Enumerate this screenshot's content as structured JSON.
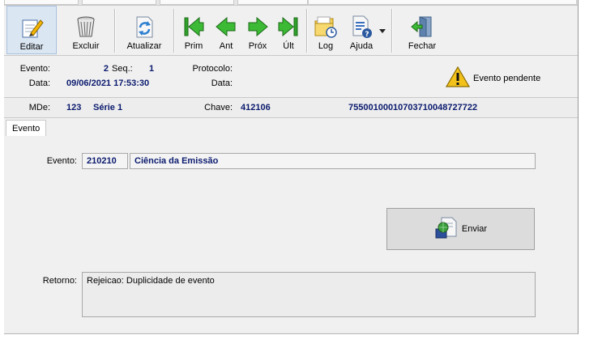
{
  "toolbar": {
    "editar": "Editar",
    "excluir": "Excluir",
    "atualizar": "Atualizar",
    "prim": "Prim",
    "ant": "Ant",
    "prox": "Próx",
    "ult": "Últ",
    "log": "Log",
    "ajuda": "Ajuda",
    "fechar": "Fechar"
  },
  "info": {
    "evento_label": "Evento:",
    "evento_value": "2",
    "seq_label": "Seq.:",
    "seq_value": "1",
    "protocolo_label": "Protocolo:",
    "protocolo_value": "",
    "data_label": "Data:",
    "data_value": "09/06/2021 17:53:30",
    "data2_label": "Data:",
    "data2_value": "",
    "status": "Evento pendente"
  },
  "mde": {
    "mde_label": "MDe:",
    "mde_number": "123",
    "serie": "Série 1",
    "chave_label": "Chave:",
    "chave_prefix": "412106",
    "chave_rest": "75500100010703710048727722"
  },
  "tabs": [
    "Evento"
  ],
  "form": {
    "evento_label": "Evento:",
    "evento_code": "210210",
    "evento_desc": "Ciência da Emissão",
    "enviar": "Enviar",
    "retorno_label": "Retorno:",
    "retorno_value": "Rejeicao: Duplicidade de evento"
  },
  "icons": {
    "editar": "pencil-notepad-icon",
    "excluir": "trash-bin-icon",
    "atualizar": "refresh-document-icon",
    "prim": "first-record-icon",
    "ant": "previous-record-icon",
    "prox": "next-record-icon",
    "ult": "last-record-icon",
    "log": "folder-clock-icon",
    "ajuda": "help-document-icon",
    "fechar": "exit-door-icon",
    "warning": "warning-icon",
    "enviar": "send-globe-icon"
  },
  "colors": {
    "value_text": "#0a1a6e",
    "nav_green": "#2fa12a",
    "warning_yellow": "#f2c21b"
  }
}
